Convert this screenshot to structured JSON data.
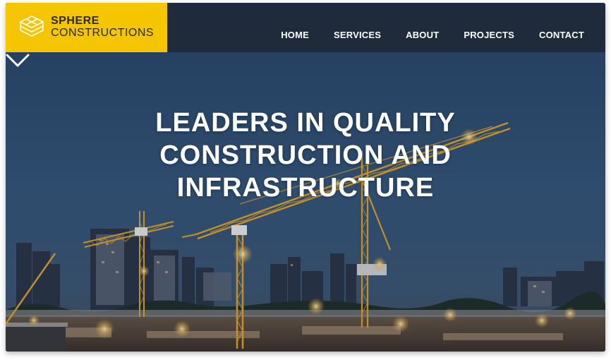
{
  "brand": {
    "name": "SPHERE",
    "subtitle": "CONSTRUCTIONS",
    "logo_icon": "stacked-diamond-icon",
    "color": "#f4c500"
  },
  "nav": {
    "items": [
      {
        "label": "HOME"
      },
      {
        "label": "SERVICES"
      },
      {
        "label": "ABOUT"
      },
      {
        "label": "PROJECTS"
      },
      {
        "label": "CONTACT"
      }
    ]
  },
  "hero": {
    "title_lines": [
      "LEADERS IN QUALITY",
      "CONSTRUCTION AND",
      "INFRASTRUCTURE"
    ],
    "scroll_icon": "chevron-down-icon",
    "background": "night construction site with tower cranes and city skyline"
  },
  "colors": {
    "header_bg": "#1f2b3b",
    "accent": "#f4c500",
    "text": "#ffffff"
  }
}
